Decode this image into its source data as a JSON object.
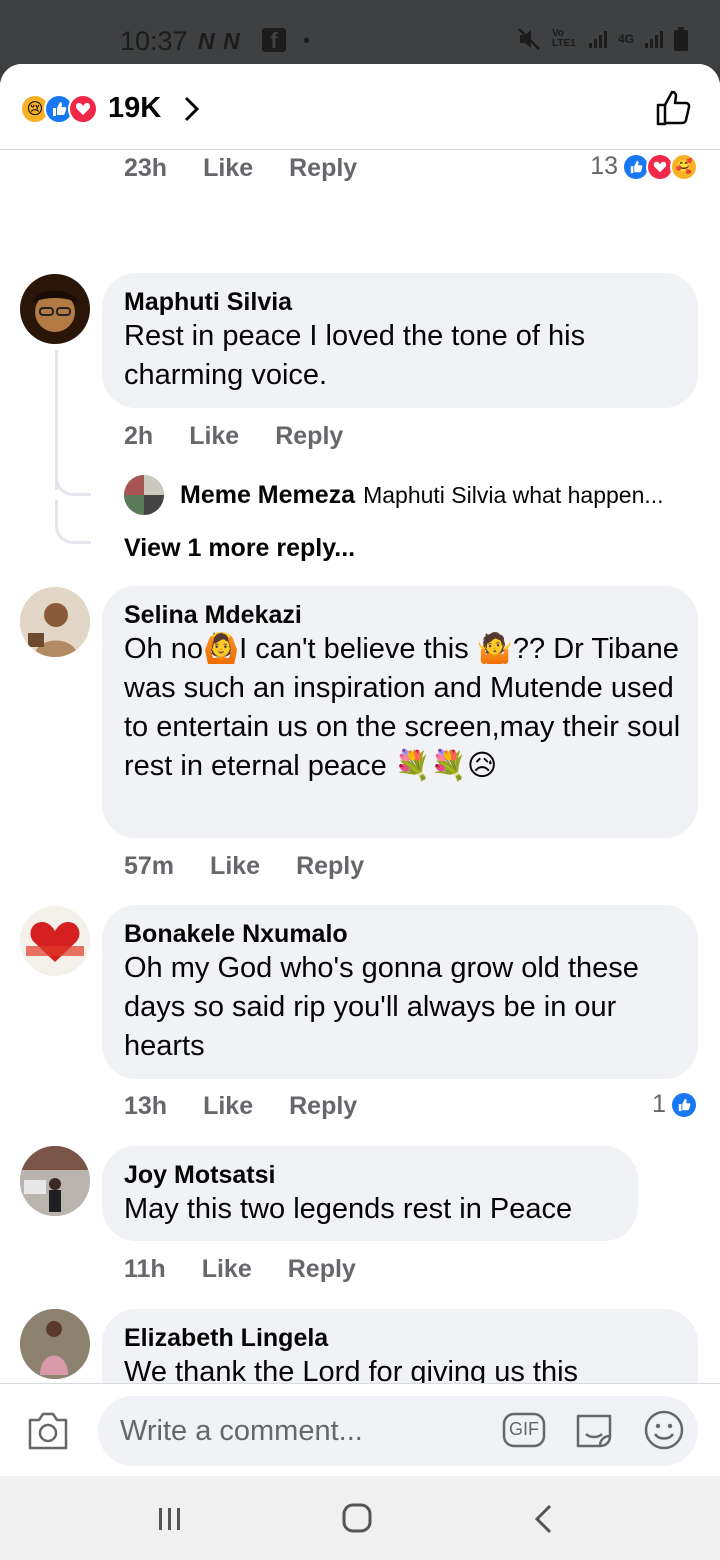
{
  "status_bar": {
    "time": "10:37",
    "net_icons": "N N",
    "fb_glyph": "f",
    "dot": "•",
    "volte": "Vo LTE1",
    "net_type": "4G"
  },
  "header": {
    "reaction_count": "19K"
  },
  "first_meta": {
    "time": "23h",
    "like": "Like",
    "reply": "Reply",
    "reaction_count": "13"
  },
  "comments": [
    {
      "author": "Maphuti Silvia",
      "text": "Rest in peace I loved the tone of his charming voice.",
      "time": "2h",
      "like": "Like",
      "reply": "Reply"
    },
    {
      "author": "Selina Mdekazi",
      "text_a": "Oh no",
      "text_b": "I can't believe this ",
      "text_c": "?? Dr Tibane was such an inspiration and Mutende used to entertain us on the screen,may their soul rest in eternal peace ",
      "emoji_1": "🙆",
      "emoji_2": "🤷",
      "emoji_end": "💐💐😥",
      "time": "57m",
      "like": "Like",
      "reply": "Reply"
    },
    {
      "author": "Bonakele Nxumalo",
      "text": "Oh my God who's gonna grow old these days so said rip you'll always be in our hearts",
      "time": "13h",
      "like": "Like",
      "reply": "Reply",
      "reaction_count": "1"
    },
    {
      "author": "Joy Motsatsi",
      "text": "May this two legends rest in Peace",
      "time": "11h",
      "like": "Like",
      "reply": "Reply"
    },
    {
      "author": "Elizabeth Lingela",
      "text": "We thank the Lord for giving us this wonderfull souls."
    }
  ],
  "reply_preview": {
    "author": "Meme Memeza",
    "text": "Maphuti Silvia what happen..."
  },
  "view_more": "View 1 more reply...",
  "composer": {
    "placeholder": "Write a comment...",
    "gif_label": "GIF"
  },
  "icons": {
    "header_reactions": [
      "sad-icon",
      "like-icon",
      "love-icon"
    ],
    "first_reactions": [
      "like-icon",
      "love-icon",
      "care-icon"
    ],
    "nav": [
      "recents-icon",
      "home-icon",
      "back-icon"
    ]
  },
  "colors": {
    "bubble": "#f0f2f5",
    "like_blue": "#1877f2",
    "love_red": "#f02849",
    "meta_gray": "#65676b"
  }
}
